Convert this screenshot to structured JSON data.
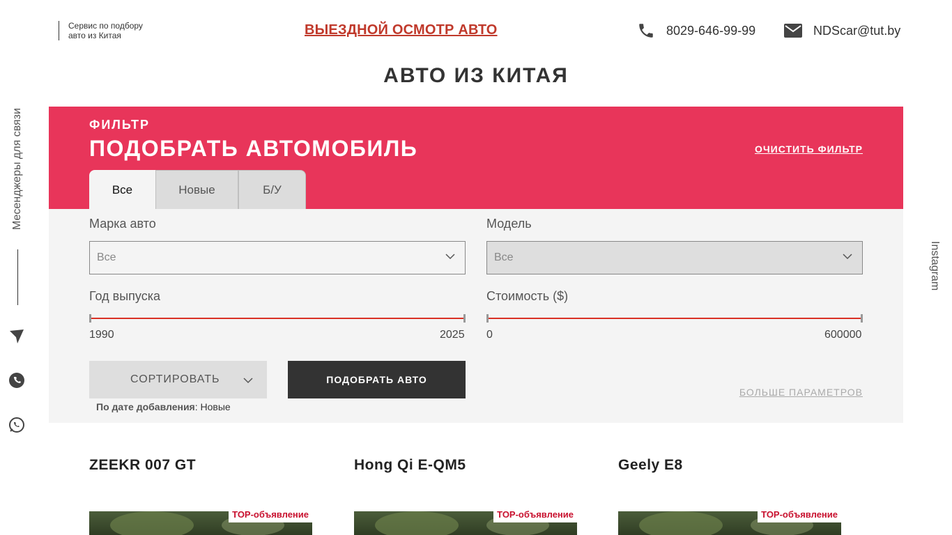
{
  "header": {
    "brand_line1": "Сервис по подбору",
    "brand_line2": "авто из Китая",
    "promo_link": "ВЫЕЗДНОЙ ОСМОТР АВТО",
    "phone": "8029-646-99-99",
    "email": "NDScar@tut.by"
  },
  "page_title": "АВТО ИЗ КИТАЯ",
  "side": {
    "messengers_label": "Месенджеры для связи",
    "instagram_label": "Instagram",
    "icons": [
      "telegram-icon",
      "whatsapp-icon",
      "viber-icon"
    ]
  },
  "filter": {
    "kicker": "ФИЛЬТР",
    "title": "ПОДОБРАТЬ АВТОМОБИЛЬ",
    "clear_label": "ОЧИСТИТЬ ФИЛЬТР",
    "tabs": [
      {
        "label": "Все",
        "active": true
      },
      {
        "label": "Новые",
        "active": false
      },
      {
        "label": "Б/У",
        "active": false
      }
    ],
    "brand": {
      "label": "Марка авто",
      "value": "Все"
    },
    "model": {
      "label": "Модель",
      "value": "Все"
    },
    "year": {
      "label": "Год выпуска",
      "min": "1990",
      "max": "2025"
    },
    "price": {
      "label": "Стоимость ($)",
      "min": "0",
      "max": "600000"
    },
    "sort_label": "СОРТИРОВАТЬ",
    "sort_info_key": "По дате добавления",
    "sort_info_value": ": Новые",
    "submit_label": "ПОДОБРАТЬ АВТО",
    "more_label": "БОЛЬШЕ ПАРАМЕТРОВ"
  },
  "cards": [
    {
      "title": "ZEEKR 007 GT",
      "badge": "TOP-объявление"
    },
    {
      "title": "Hong Qi E-QM5",
      "badge": "TOP-объявление"
    },
    {
      "title": "Geely E8",
      "badge": "TOP-объявление"
    }
  ],
  "colors": {
    "accent": "#e8355a",
    "link": "#c0392b",
    "badge": "#c8102e",
    "dark_button": "#333333"
  }
}
